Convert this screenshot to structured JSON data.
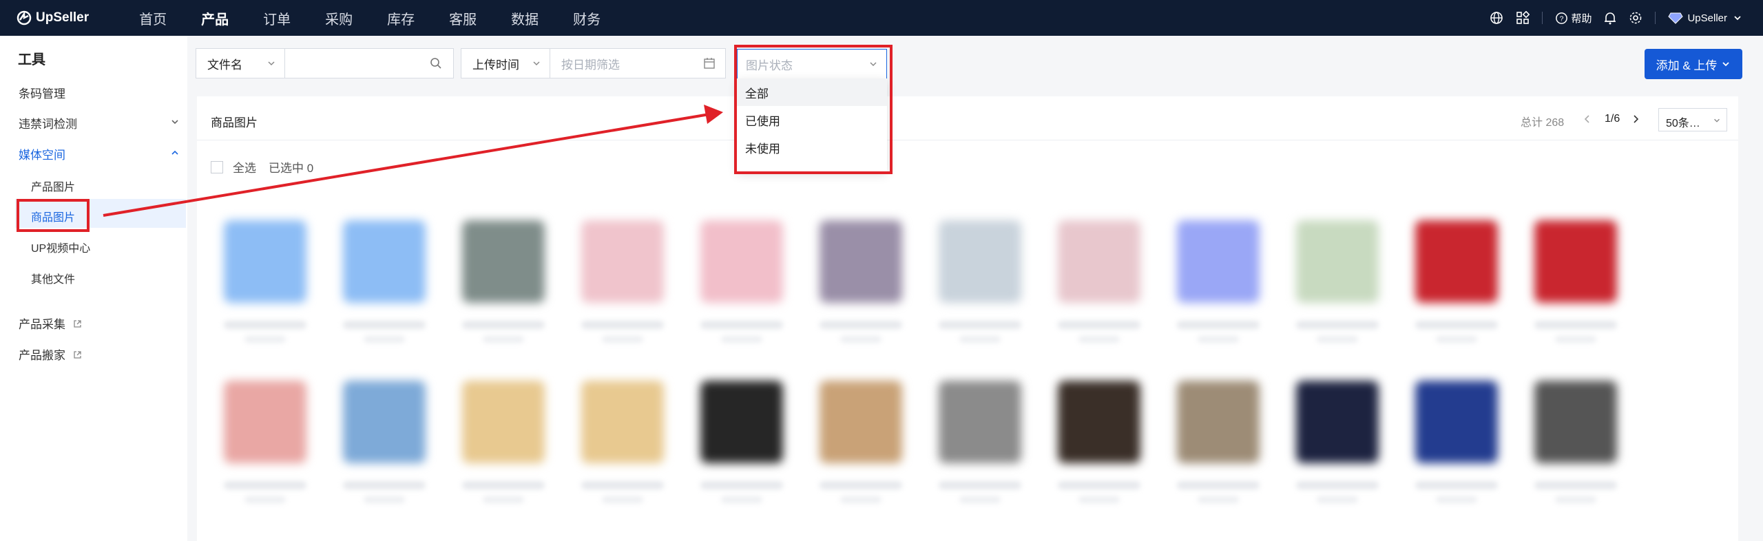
{
  "app": {
    "logo": "UpSeller"
  },
  "nav": [
    "首页",
    "产品",
    "订单",
    "采购",
    "库存",
    "客服",
    "数据",
    "财务"
  ],
  "nav_active": "产品",
  "top_right": {
    "help": "帮助",
    "user": "UpSeller"
  },
  "sidebar": {
    "title": "工具",
    "items": [
      {
        "label": "条码管理"
      },
      {
        "label": "违禁词检测"
      },
      {
        "label": "媒体空间"
      },
      {
        "label": "产品图片"
      },
      {
        "label": "商品图片"
      },
      {
        "label": "UP视频中心"
      },
      {
        "label": "其他文件"
      },
      {
        "label": "产品采集"
      },
      {
        "label": "产品搬家"
      }
    ]
  },
  "filters": {
    "filename_select": "文件名",
    "upload_time_select": "上传时间",
    "date_placeholder": "按日期筛选",
    "status_placeholder": "图片状态"
  },
  "add_button": "添加 & 上传",
  "panel": {
    "title": "商品图片",
    "total": "总计 268",
    "page": "1/6",
    "page_size": "50条…",
    "select_all": "全选",
    "selected": "已选中 0"
  },
  "status_dropdown": {
    "options": [
      "全部",
      "已使用",
      "未使用"
    ],
    "hovered": "全部"
  },
  "colors": {
    "accent": "#1559d6",
    "nav_bg": "#0f1c33",
    "highlight": "#e02128"
  }
}
